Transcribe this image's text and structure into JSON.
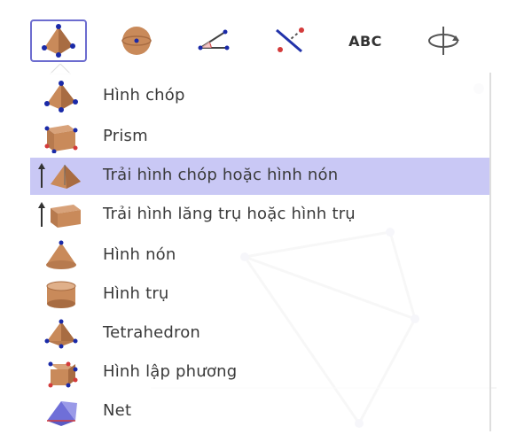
{
  "toolbar": {
    "tools": [
      {
        "icon": "pyramid-icon",
        "selected": true
      },
      {
        "icon": "sphere-icon",
        "selected": false
      },
      {
        "icon": "angle-icon",
        "selected": false
      },
      {
        "icon": "reflect-line-icon",
        "selected": false
      },
      {
        "icon": "text-icon",
        "label": "ABC",
        "selected": false
      },
      {
        "icon": "rotate-view-icon",
        "selected": false
      }
    ]
  },
  "menu": {
    "items": [
      {
        "label": "Hình chóp",
        "icon": "pyramid-icon",
        "highlighted": false
      },
      {
        "label": "Prism",
        "icon": "prism-icon",
        "highlighted": false
      },
      {
        "label": "Trải hình chóp hoặc hình nón",
        "icon": "extrude-pyramid-icon",
        "highlighted": true
      },
      {
        "label": "Trải hình lăng trụ hoặc hình trụ",
        "icon": "extrude-prism-icon",
        "highlighted": false
      },
      {
        "label": "Hình nón",
        "icon": "cone-icon",
        "highlighted": false
      },
      {
        "label": "Hình trụ",
        "icon": "cylinder-icon",
        "highlighted": false
      },
      {
        "label": "Tetrahedron",
        "icon": "tetrahedron-icon",
        "highlighted": false
      },
      {
        "label": "Hình lập phương",
        "icon": "cube-icon",
        "highlighted": false
      },
      {
        "label": "Net",
        "icon": "net-icon",
        "highlighted": false
      }
    ]
  },
  "colors": {
    "selection_border": "#6c6ccf",
    "highlight_row": "#c9c8f5",
    "solid_fill": "#c98a5a",
    "vertex_blue": "#1a2aa8"
  }
}
